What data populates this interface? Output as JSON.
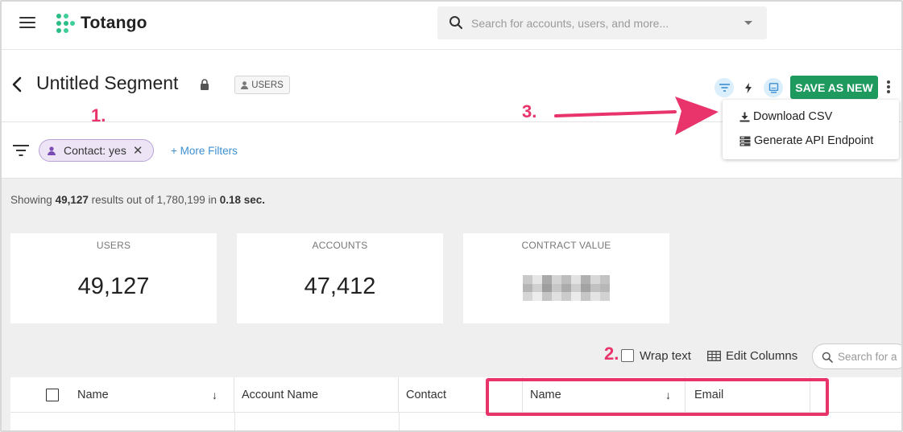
{
  "app": {
    "logo_text": "Totango",
    "search_placeholder": "Search for accounts, users, and more..."
  },
  "segment": {
    "title": "Untitled Segment",
    "badge": "USERS",
    "save_label": "SAVE AS NEW"
  },
  "menu": {
    "items": [
      "Download CSV",
      "Generate API Endpoint"
    ]
  },
  "filters": {
    "chip_label": "Contact: yes",
    "chip_remove": "✕",
    "more_label": "+ More Filters"
  },
  "results": {
    "prefix": "Showing",
    "count": "49,127",
    "middle": "results out of 1,780,199 in",
    "time": "0.18 sec."
  },
  "cards": [
    {
      "label": "USERS",
      "value": "49,127"
    },
    {
      "label": "ACCOUNTS",
      "value": "47,412"
    },
    {
      "label": "CONTRACT VALUE",
      "value": ""
    }
  ],
  "table_tools": {
    "wrap_label": "Wrap text",
    "edit_columns_label": "Edit Columns",
    "search_placeholder": "Search for a"
  },
  "columns": [
    "Name",
    "Account Name",
    "Contact",
    "Name",
    "Email"
  ],
  "annotations": [
    "1.",
    "2.",
    "3."
  ],
  "colors": {
    "brand_green": "#1e9a5f",
    "annotation_pink": "#e8336b",
    "chip_purple": "#ede5f6",
    "link_blue": "#3d8fd1"
  }
}
